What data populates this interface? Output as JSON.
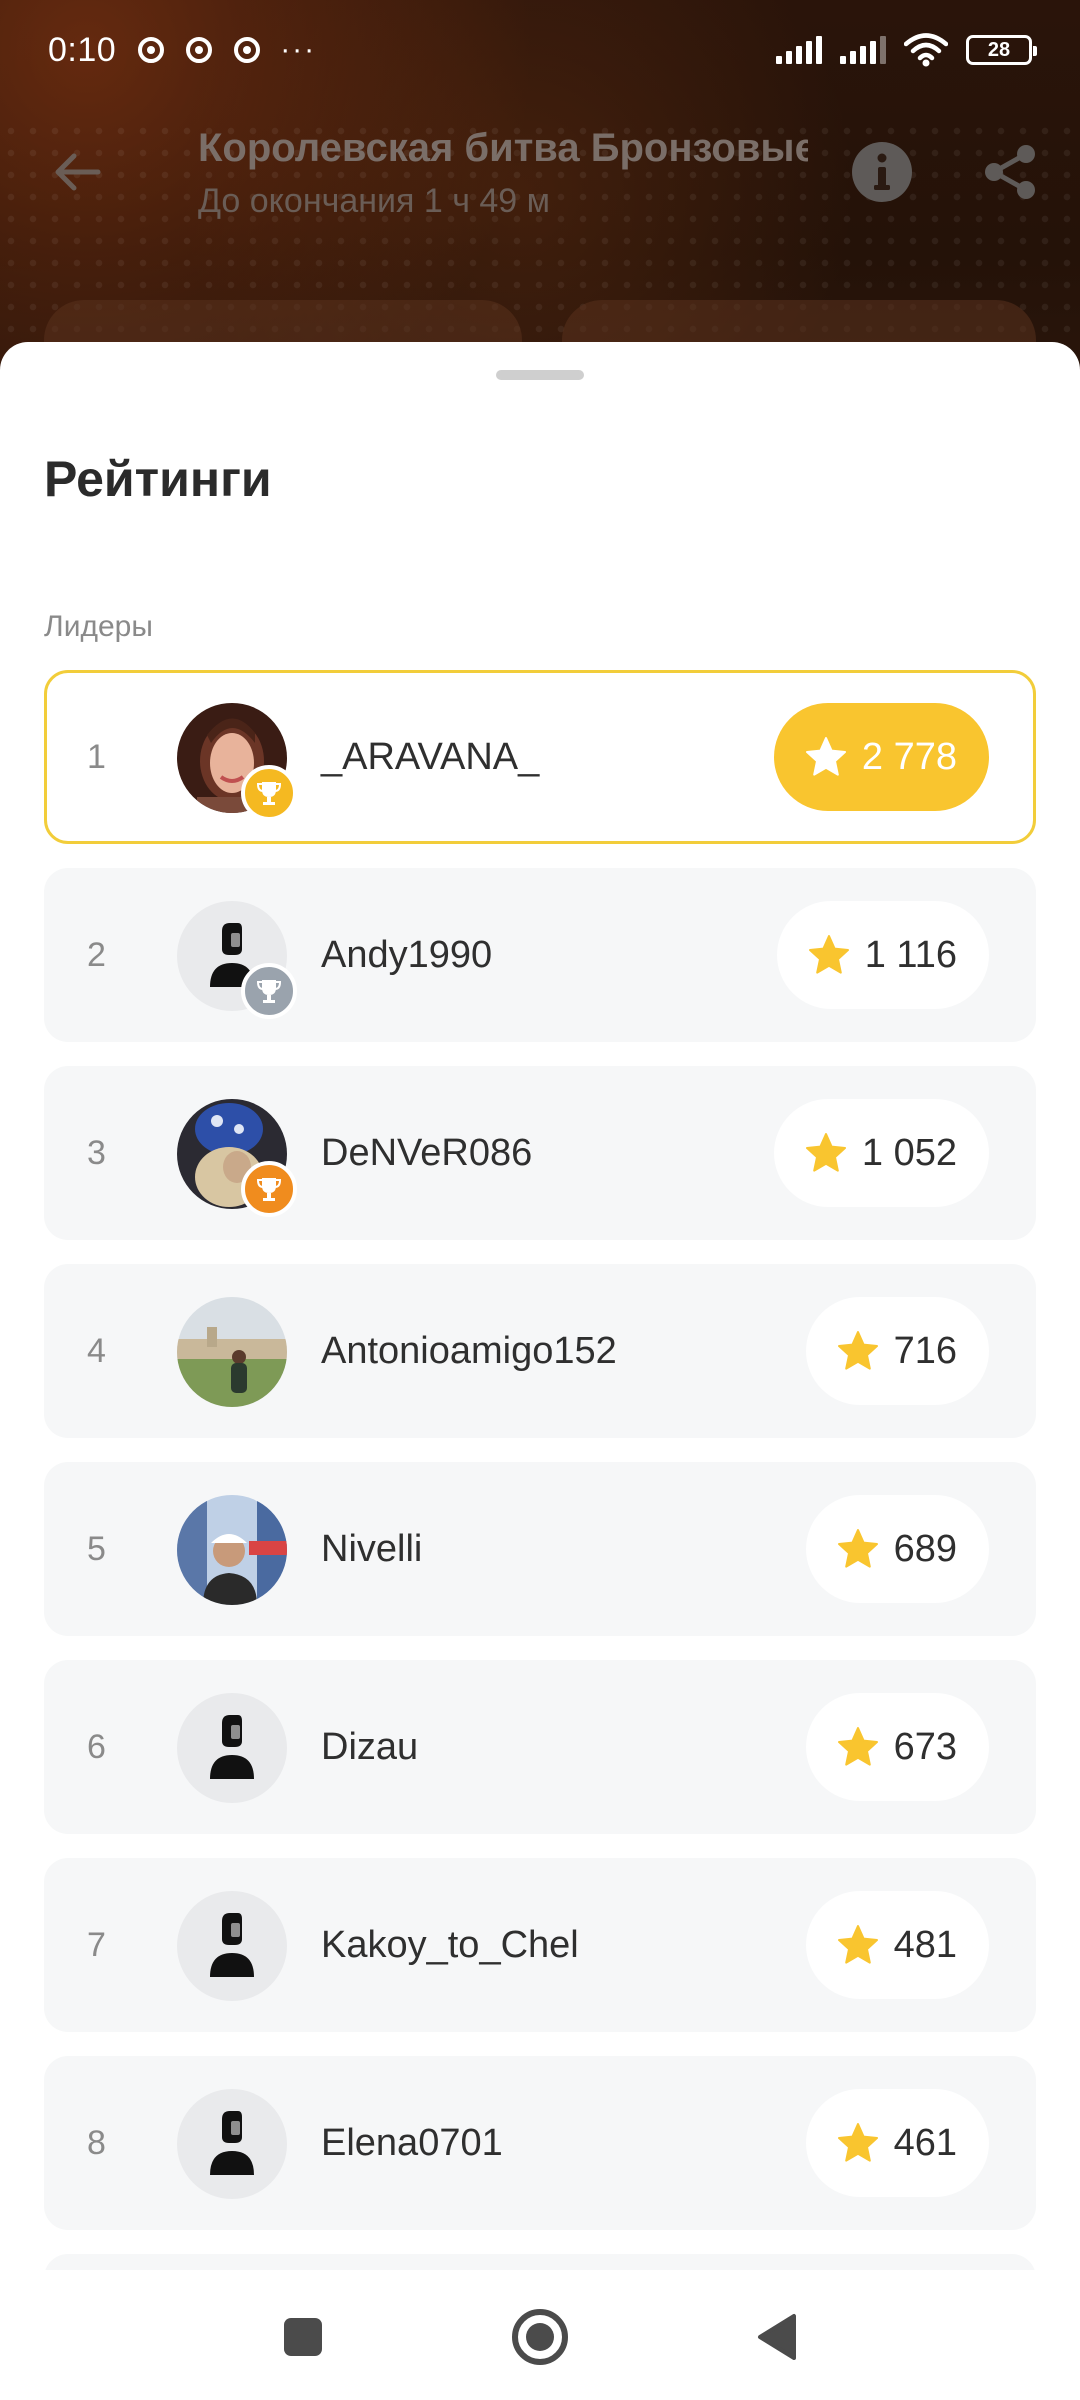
{
  "status_bar": {
    "time": "0:10",
    "more": "···",
    "battery": "28",
    "icons": [
      "chrome-icon",
      "chrome-icon",
      "chrome-icon",
      "signal-icon",
      "signal-icon",
      "wifi-icon",
      "battery-icon"
    ]
  },
  "app_bar": {
    "title": "Королевская битва Бронзовые",
    "subtitle": "До окончания 1 ч 49 м",
    "icons": [
      "back-arrow-icon",
      "info-icon",
      "share-icon"
    ]
  },
  "sheet": {
    "title": "Рейтинги",
    "section_label": "Лидеры"
  },
  "leaders": [
    {
      "rank": "1",
      "name": "_ARAVANA_",
      "score": "2 778",
      "trophy": "gold",
      "avatar": "photo"
    },
    {
      "rank": "2",
      "name": "Andy1990",
      "score": "1 116",
      "trophy": "silver",
      "avatar": "placeholder"
    },
    {
      "rank": "3",
      "name": "DeNVeR086",
      "score": "1 052",
      "trophy": "bronze",
      "avatar": "photo"
    },
    {
      "rank": "4",
      "name": "Antonioamigo152",
      "score": "716",
      "trophy": "",
      "avatar": "photo"
    },
    {
      "rank": "5",
      "name": "Nivelli",
      "score": "689",
      "trophy": "",
      "avatar": "photo"
    },
    {
      "rank": "6",
      "name": "Dizau",
      "score": "673",
      "trophy": "",
      "avatar": "placeholder"
    },
    {
      "rank": "7",
      "name": "Kakoy_to_Chel",
      "score": "481",
      "trophy": "",
      "avatar": "placeholder"
    },
    {
      "rank": "8",
      "name": "Elena0701",
      "score": "461",
      "trophy": "",
      "avatar": "placeholder"
    }
  ],
  "colors": {
    "accent": "#f9c52f",
    "leader_border": "#f2cd3a",
    "row_bg": "#f6f7f8",
    "gold": "#f5b921",
    "silver": "#9aa3ad",
    "bronze": "#f08c1e"
  },
  "nav_bar": {
    "icons": [
      "recents-square-icon",
      "home-circle-icon",
      "back-triangle-icon"
    ]
  }
}
